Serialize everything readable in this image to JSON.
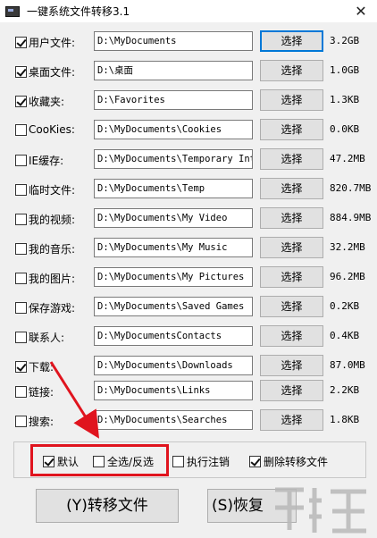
{
  "window": {
    "title": "一键系统文件转移3.1",
    "close_glyph": "✕"
  },
  "rows": [
    {
      "label": "用户文件:",
      "checked": true,
      "path": "D:\\MyDocuments",
      "button": "选择",
      "size": "3.2GB"
    },
    {
      "label": "桌面文件:",
      "checked": true,
      "path": "D:\\桌面",
      "button": "选择",
      "size": "1.0GB"
    },
    {
      "label": "收藏夹:",
      "checked": true,
      "path": "D:\\Favorites",
      "button": "选择",
      "size": "1.3KB"
    },
    {
      "label": "CooKies:",
      "checked": false,
      "path": "D:\\MyDocuments\\Cookies",
      "button": "选择",
      "size": "0.0KB"
    },
    {
      "label": "IE缓存:",
      "checked": false,
      "path": "D:\\MyDocuments\\Temporary Inte",
      "button": "选择",
      "size": "47.2MB"
    },
    {
      "label": "临时文件:",
      "checked": false,
      "path": "D:\\MyDocuments\\Temp",
      "button": "选择",
      "size": "820.7MB"
    },
    {
      "label": "我的视频:",
      "checked": false,
      "path": "D:\\MyDocuments\\My Video",
      "button": "选择",
      "size": "884.9MB"
    },
    {
      "label": "我的音乐:",
      "checked": false,
      "path": "D:\\MyDocuments\\My Music",
      "button": "选择",
      "size": "32.2MB"
    },
    {
      "label": "我的图片:",
      "checked": false,
      "path": "D:\\MyDocuments\\My Pictures",
      "button": "选择",
      "size": "96.2MB"
    },
    {
      "label": "保存游戏:",
      "checked": false,
      "path": "D:\\MyDocuments\\Saved Games",
      "button": "选择",
      "size": "0.2KB"
    },
    {
      "label": "联系人:",
      "checked": false,
      "path": "D:\\MyDocumentsContacts",
      "button": "选择",
      "size": "0.4KB"
    },
    {
      "label": "下载:",
      "checked": true,
      "path": "D:\\MyDocuments\\Downloads",
      "button": "选择",
      "size": "87.0MB"
    },
    {
      "label": "链接:",
      "checked": false,
      "path": "D:\\MyDocuments\\Links",
      "button": "选择",
      "size": "2.2KB"
    },
    {
      "label": "搜索:",
      "checked": false,
      "path": "D:\\MyDocuments\\Searches",
      "button": "选择",
      "size": "1.8KB"
    }
  ],
  "options": {
    "default": {
      "label": "默认",
      "checked": true
    },
    "select_all": {
      "label": "全选/反选",
      "checked": false
    },
    "run_logoff": {
      "label": "执行注销",
      "checked": false
    },
    "delete_moved": {
      "label": "删除转移文件",
      "checked": true
    }
  },
  "actions": {
    "transfer_label": "(Y)转移文件",
    "restore_label": "(S)恢复"
  },
  "annotation": {
    "highlight_color": "#e0141e",
    "arrow_color": "#e0141e"
  }
}
